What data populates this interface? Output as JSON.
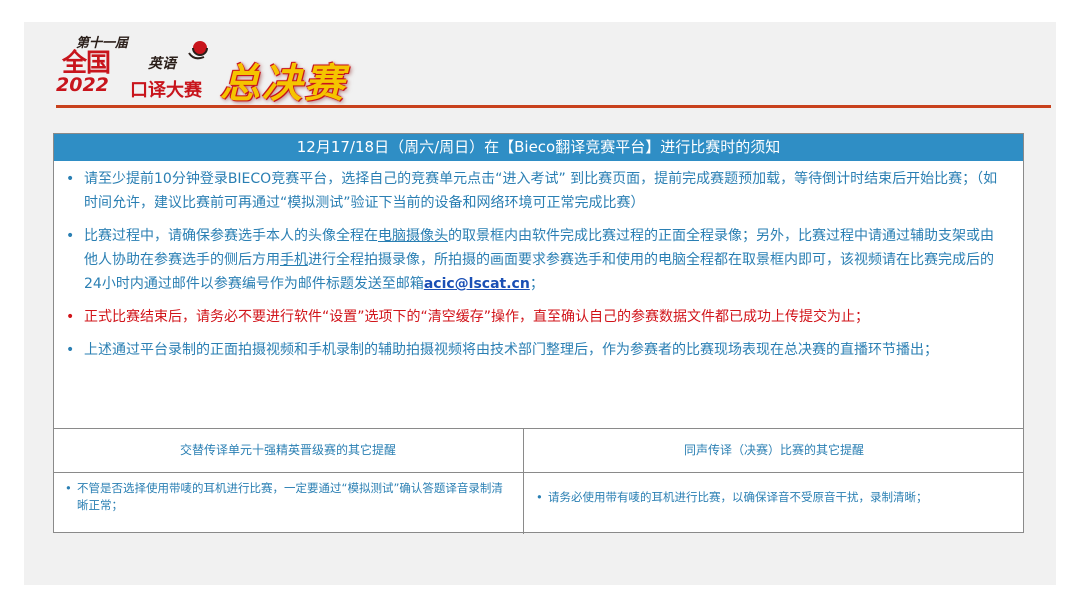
{
  "logo": {
    "edition": "第十一届",
    "nation": "全国",
    "year": "2022",
    "english": "英语",
    "contest": "口译大赛",
    "final": "总决赛"
  },
  "colors": {
    "brand_red": "#c8151c",
    "header_blue": "#2f8ec5",
    "text_blue": "#2a7fb3",
    "alert_red": "#d1141a",
    "gold": "#f5c400"
  },
  "notice": {
    "title": "12月17/18日（周六/周日）在【Bieco翻译竞赛平台】进行比赛时的须知",
    "item1": "请至少提前10分钟登录BIECO竞赛平台，选择自己的竞赛单元点击“进入考试” 到比赛页面，提前完成赛题预加载，等待倒计时结束后开始比赛；（如时间允许，建议比赛前可再通过“模拟测试”验证下当前的设备和网络环境可正常完成比赛）",
    "item2_a": "比赛过程中，请确保参赛选手本人的头像全程在",
    "item2_b": "电脑摄像头",
    "item2_c": "的取景框内由软件完成比赛过程的正面全程录像；另外，比赛过程中请通过辅助支架或由他人协助在参赛选手的侧后方用",
    "item2_d": "手机",
    "item2_e": "进行全程拍摄录像，所拍摄的画面要求参赛选手和使用的电脑全程都在取景框内即可，该视频请在比赛完成后的24小时内通过邮件以参赛编号作为邮件标题发送至邮箱",
    "item2_email": "acic@lscat.cn",
    "item2_f": "；",
    "item3": "正式比赛结束后，请务必不要进行软件“设置”选项下的“清空缓存”操作，直至确认自己的参赛数据文件都已成功上传提交为止；",
    "item4": "上述通过平台录制的正面拍摄视频和手机录制的辅助拍摄视频将由技术部门整理后，作为参赛者的比赛现场表现在总决赛的直播环节播出；"
  },
  "reminders": {
    "left_title": "交替传译单元十强精英晋级赛的其它提醒",
    "left_item": "不管是否选择使用带唛的耳机进行比赛，一定要通过“模拟测试”确认答题译音录制清晰正常；",
    "right_title": "同声传译（决赛）比赛的其它提醒",
    "right_item": "请务必使用带有唛的耳机进行比赛，以确保译音不受原音干扰，录制清晰；"
  }
}
